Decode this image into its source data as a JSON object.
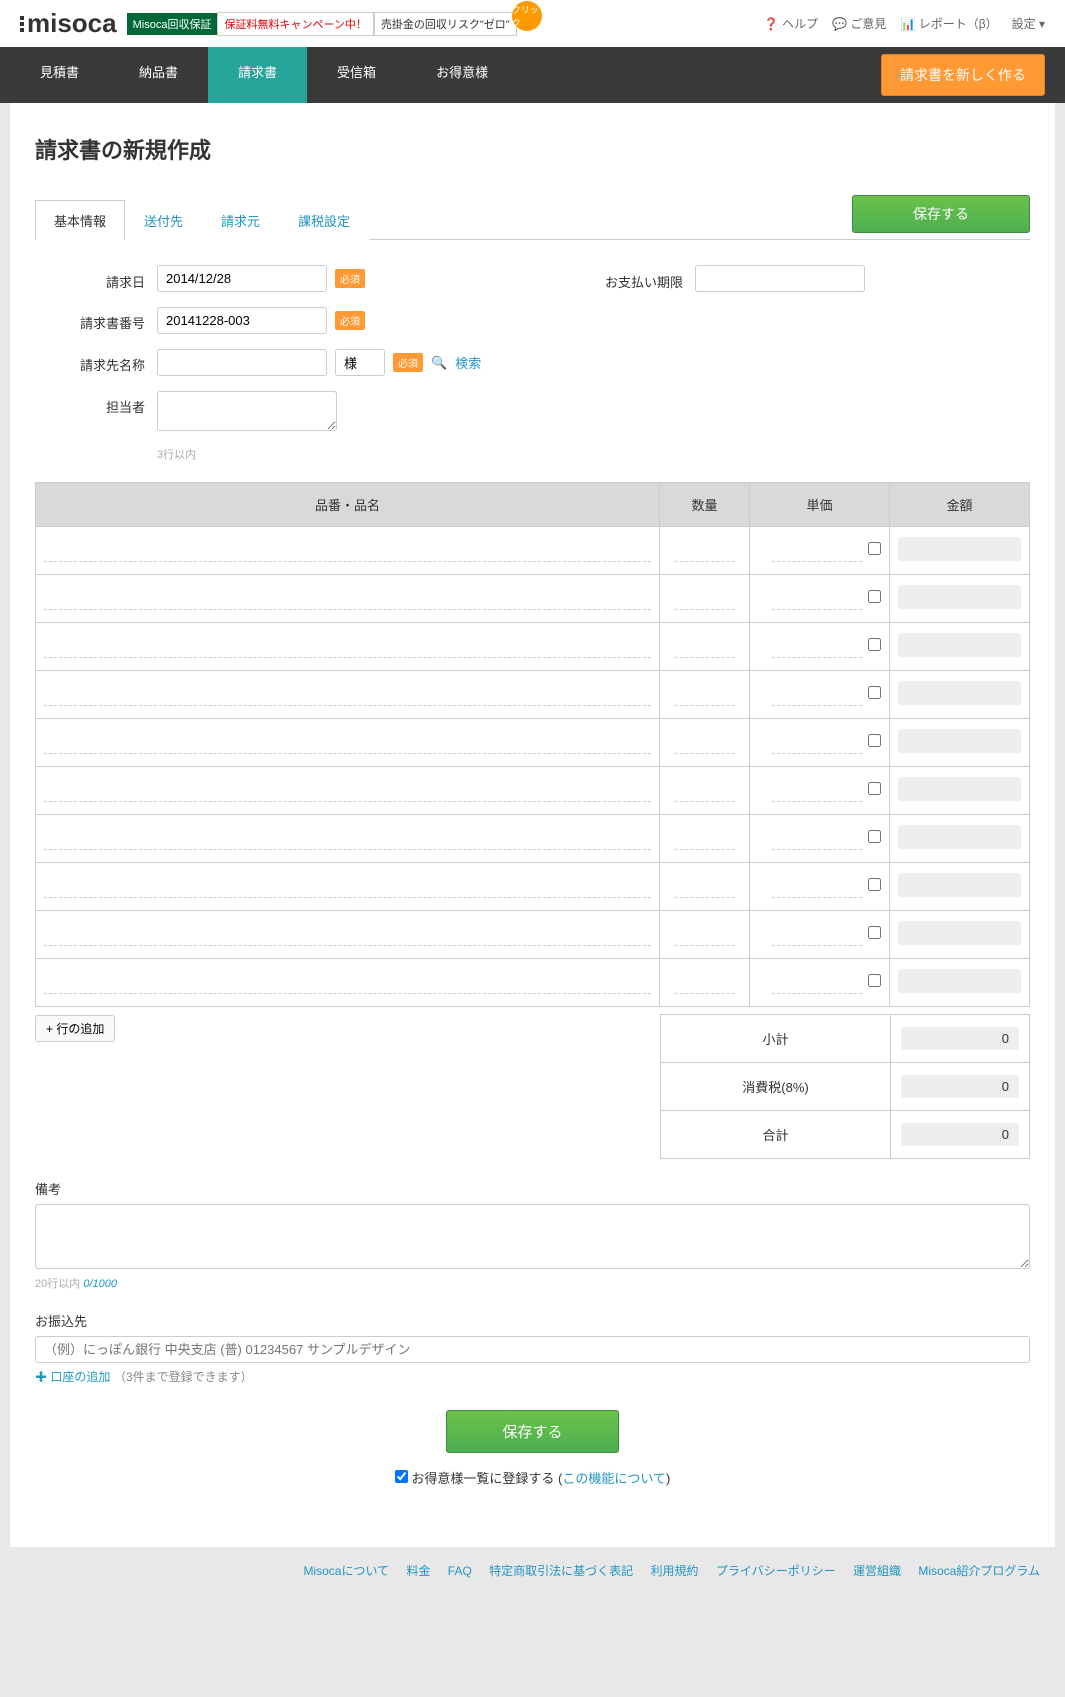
{
  "header": {
    "logo": "misoca",
    "promo": {
      "tag1": "Misoca回収保証",
      "tag2": "保証料無料キャンペーン中！",
      "tag3": "売掛金の回収リスク\"ゼロ\"",
      "click": "クリック"
    },
    "links": {
      "help": "ヘルプ",
      "feedback": "ご意見",
      "report": "レポート（β）",
      "settings": "設定"
    }
  },
  "nav": {
    "items": [
      "見積書",
      "納品書",
      "請求書",
      "受信箱",
      "お得意様"
    ],
    "cta": "請求書を新しく作る"
  },
  "page": {
    "title": "請求書の新規作成"
  },
  "tabs": {
    "items": [
      "基本情報",
      "送付先",
      "請求元",
      "課税設定"
    ],
    "save": "保存する"
  },
  "form": {
    "invoice_date": {
      "label": "請求日",
      "value": "2014/12/28",
      "required": "必須"
    },
    "due_date": {
      "label": "お支払い期限",
      "value": ""
    },
    "invoice_number": {
      "label": "請求書番号",
      "value": "20141228-003",
      "required": "必須"
    },
    "client_name": {
      "label": "請求先名称",
      "value": "",
      "honorific": "様",
      "required": "必須",
      "search": "検索"
    },
    "assignee": {
      "label": "担当者",
      "value": "",
      "note": "3行以内"
    }
  },
  "items_table": {
    "headers": {
      "desc": "品番・品名",
      "qty": "数量",
      "price": "単価",
      "amount": "金額"
    },
    "row_count": 10,
    "add_row": "+ 行の追加"
  },
  "totals": {
    "subtotal": {
      "label": "小計",
      "value": "0"
    },
    "tax": {
      "label": "消費税(8%)",
      "value": "0"
    },
    "total": {
      "label": "合計",
      "value": "0"
    }
  },
  "remarks": {
    "label": "備考",
    "counter_prefix": "20行以内 ",
    "counter": "0/1000"
  },
  "bank": {
    "label": "お振込先",
    "placeholder": "（例）にっぽん銀行 中央支店 (普) 01234567 サンプルデザイン",
    "add": "口座の追加",
    "add_note": "（3件まで登録できます）"
  },
  "bottom": {
    "save": "保存する",
    "register": "お得意様一覧に登録する",
    "register_link": "この機能について"
  },
  "footer": {
    "links": [
      "Misocaについて",
      "料金",
      "FAQ",
      "特定商取引法に基づく表記",
      "利用規約",
      "プライバシーポリシー",
      "運営組織",
      "Misoca紹介プログラム"
    ]
  }
}
